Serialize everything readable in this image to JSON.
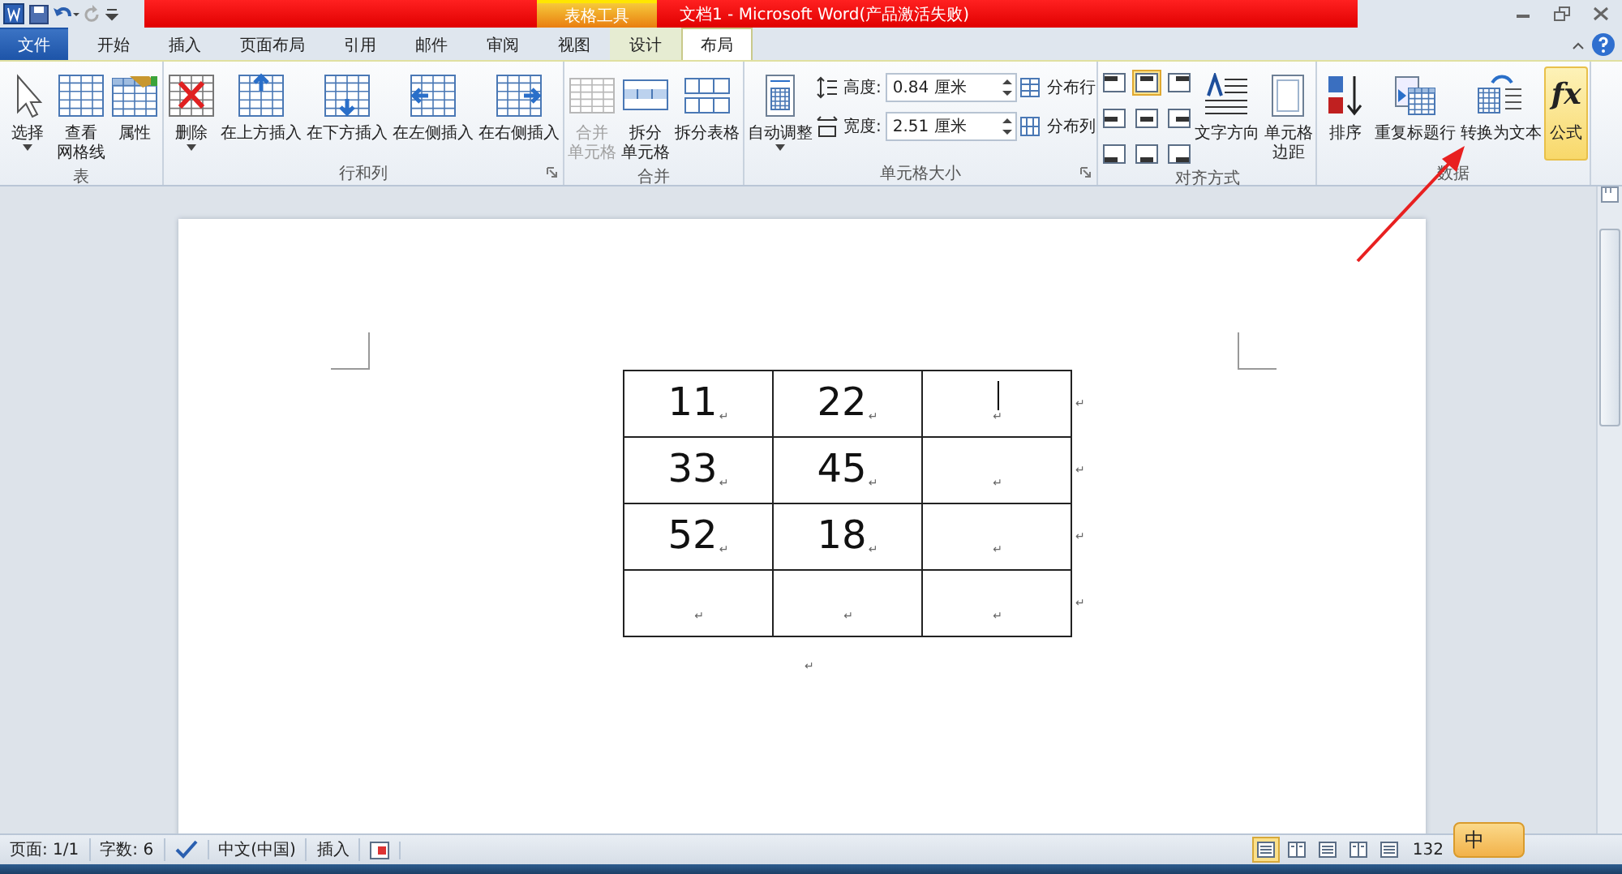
{
  "title_bar": {
    "context_label": "表格工具",
    "title": "文档1  -  Microsoft Word(产品激活失败)"
  },
  "tabs": [
    {
      "label": "文件",
      "kind": "file",
      "selected": false
    },
    {
      "label": "开始",
      "kind": "normal",
      "selected": false
    },
    {
      "label": "插入",
      "kind": "normal",
      "selected": false
    },
    {
      "label": "页面布局",
      "kind": "normal",
      "selected": false
    },
    {
      "label": "引用",
      "kind": "normal",
      "selected": false
    },
    {
      "label": "邮件",
      "kind": "normal",
      "selected": false
    },
    {
      "label": "审阅",
      "kind": "normal",
      "selected": false
    },
    {
      "label": "视图",
      "kind": "normal",
      "selected": false
    },
    {
      "label": "设计",
      "kind": "context",
      "selected": false
    },
    {
      "label": "布局",
      "kind": "context",
      "selected": true
    }
  ],
  "ribbon": [
    {
      "label": "表",
      "items": [
        {
          "kind": "large",
          "lines": [
            "选择"
          ],
          "dropdown": true
        },
        {
          "kind": "large",
          "lines": [
            "查看",
            "网格线"
          ]
        },
        {
          "kind": "large",
          "lines": [
            "属性"
          ]
        }
      ]
    },
    {
      "label": "行和列",
      "launcher": true,
      "items": [
        {
          "kind": "large",
          "lines": [
            "删除"
          ],
          "dropdown": true
        },
        {
          "kind": "large",
          "lines": [
            "在上方插入"
          ]
        },
        {
          "kind": "large",
          "lines": [
            "在下方插入"
          ]
        },
        {
          "kind": "large",
          "lines": [
            "在左侧插入"
          ]
        },
        {
          "kind": "large",
          "lines": [
            "在右侧插入"
          ]
        }
      ]
    },
    {
      "label": "合并",
      "items": [
        {
          "kind": "large",
          "lines": [
            "合并",
            "单元格"
          ],
          "disabled": true
        },
        {
          "kind": "large",
          "lines": [
            "拆分",
            "单元格"
          ],
          "disabled": false
        },
        {
          "kind": "large",
          "lines": [
            "拆分表格"
          ],
          "disabled": false
        }
      ]
    },
    {
      "label": "单元格大小",
      "launcher": true,
      "items": [
        {
          "kind": "large",
          "lines": [
            "自动调整"
          ],
          "dropdown": true
        },
        {
          "kind": "spins",
          "fields": [
            {
              "label": "高度:",
              "value": "0.84 厘米"
            },
            {
              "label": "宽度:",
              "value": "2.51 厘米"
            }
          ]
        },
        {
          "kind": "smalls",
          "buttons": [
            {
              "label": "分布行"
            },
            {
              "label": "分布列"
            }
          ]
        }
      ]
    },
    {
      "label": "对齐方式",
      "items": [
        {
          "kind": "align_grid",
          "cells": [
            {
              "selected": false
            },
            {
              "selected": true
            },
            {
              "selected": false
            },
            {
              "selected": false
            },
            {
              "selected": false
            },
            {
              "selected": false
            },
            {
              "selected": false
            },
            {
              "selected": false
            },
            {
              "selected": false
            }
          ]
        },
        {
          "kind": "large",
          "lines": [
            "文字方向"
          ]
        },
        {
          "kind": "large",
          "lines": [
            "单元格",
            "边距"
          ]
        }
      ]
    },
    {
      "label": "数据",
      "items": [
        {
          "kind": "large",
          "lines": [
            "排序"
          ],
          "highlighted": false
        },
        {
          "kind": "large",
          "lines": [
            "重复标题行"
          ],
          "highlighted": false
        },
        {
          "kind": "large",
          "lines": [
            "转换为文本"
          ],
          "highlighted": false
        },
        {
          "kind": "large",
          "lines": [
            "公式"
          ],
          "icon_text": "fx",
          "highlighted": true
        }
      ]
    }
  ],
  "document": {
    "table": {
      "rows": [
        {
          "cells": [
            {
              "text": "11",
              "mark": "↵",
              "cursor": false
            },
            {
              "text": "22",
              "mark": "↵",
              "cursor": false
            },
            {
              "text": "",
              "mark": "↵",
              "cursor": true
            }
          ],
          "row_mark": "↵"
        },
        {
          "cells": [
            {
              "text": "33",
              "mark": "↵",
              "cursor": false
            },
            {
              "text": "45",
              "mark": "↵",
              "cursor": false
            },
            {
              "text": "",
              "mark": "↵",
              "cursor": false
            }
          ],
          "row_mark": "↵"
        },
        {
          "cells": [
            {
              "text": "52",
              "mark": "↵",
              "cursor": false
            },
            {
              "text": "18",
              "mark": "↵",
              "cursor": false
            },
            {
              "text": "",
              "mark": "↵",
              "cursor": false
            }
          ],
          "row_mark": "↵"
        },
        {
          "cells": [
            {
              "text": "",
              "mark": "↵",
              "cursor": false
            },
            {
              "text": "",
              "mark": "↵",
              "cursor": false
            },
            {
              "text": "",
              "mark": "↵",
              "cursor": false
            }
          ],
          "row_mark": "↵"
        }
      ]
    },
    "paragraph_mark": "↵"
  },
  "status_bar": {
    "left": [
      {
        "kind": "text",
        "label": "页面: 1/1"
      },
      {
        "kind": "text",
        "label": "字数: 6"
      },
      {
        "kind": "proofing"
      },
      {
        "kind": "text",
        "label": "中文(中国)"
      },
      {
        "kind": "text",
        "label": "插入"
      },
      {
        "kind": "macro"
      }
    ],
    "views": [
      {
        "selected": true
      },
      {
        "selected": false
      },
      {
        "selected": false
      },
      {
        "selected": false
      },
      {
        "selected": false
      }
    ],
    "zoom": "132"
  },
  "ime": {
    "label": "中"
  }
}
